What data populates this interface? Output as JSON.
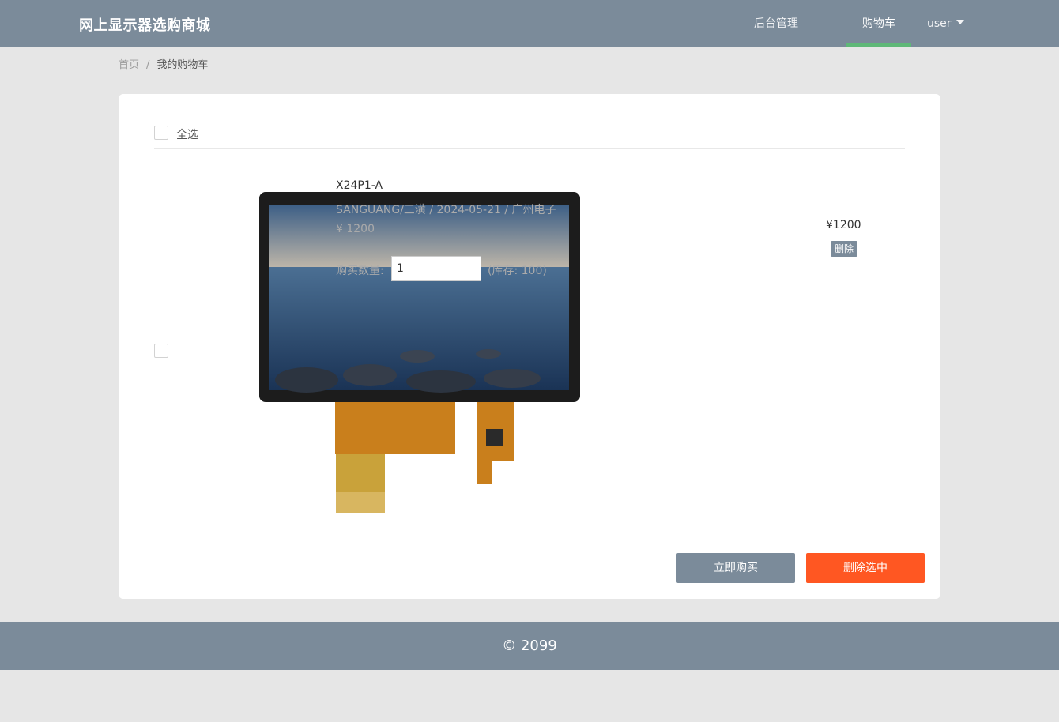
{
  "header": {
    "logo": "网上显示器选购商城",
    "nav_admin": "后台管理",
    "nav_cart": "购物车",
    "nav_user": "user",
    "accent_color": "#5fb878",
    "bg_color": "#7b8b9a"
  },
  "breadcrumb": {
    "home": "首页",
    "separator": "/",
    "current": "我的购物车"
  },
  "cart": {
    "select_all_label": "全选",
    "items": [
      {
        "name": "X24P1-A",
        "meta": "SANGUANG/三潢 / 2024-05-21 / 广州电子",
        "price_small": "¥ 1200",
        "qty_label": "购买数量:",
        "qty_value": "1",
        "stock": "(库存: 100)",
        "price": "¥1200",
        "delete_label": "删除"
      }
    ],
    "buy_now_label": "立即购买",
    "delete_selected_label": "删除选中",
    "danger_color": "#ff5722"
  },
  "footer": {
    "copyright": "© 2099"
  }
}
